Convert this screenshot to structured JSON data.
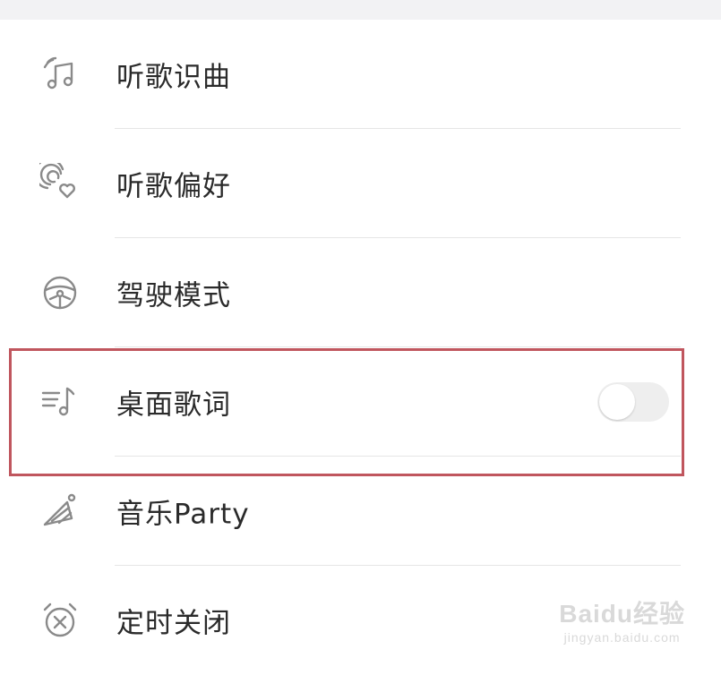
{
  "menu": {
    "items": [
      {
        "label": "听歌识曲",
        "icon": "music-recognition-icon"
      },
      {
        "label": "听歌偏好",
        "icon": "listening-preference-icon"
      },
      {
        "label": "驾驶模式",
        "icon": "steering-wheel-icon"
      },
      {
        "label": "桌面歌词",
        "icon": "desktop-lyrics-icon",
        "toggle": {
          "on": false
        }
      },
      {
        "label": "音乐Party",
        "icon": "party-hat-icon"
      },
      {
        "label": "定时关闭",
        "icon": "alarm-clock-off-icon"
      }
    ]
  },
  "watermark": {
    "main": "Baidu经验",
    "sub": "jingyan.baidu.com"
  },
  "colors": {
    "highlight": "#c0565e",
    "icon": "#8a8a8a",
    "text": "#2a2a2a",
    "divider": "#e6e6e6",
    "toggle_track": "#eeeeee"
  }
}
